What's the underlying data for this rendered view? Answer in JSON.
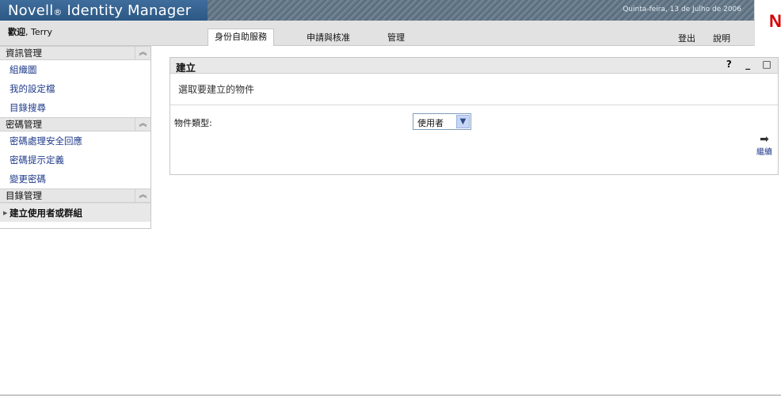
{
  "header": {
    "brand": "Novell",
    "brand_reg": "®",
    "brand_suffix": " Identity Manager",
    "date": "Quinta-feira, 13 de Julho de 2006",
    "logo_letter": "N"
  },
  "subheader": {
    "welcome_label": "歡迎",
    "welcome_user": ", Terry"
  },
  "tabs": {
    "self_service": "身份自助服務",
    "requests": "申請與核准",
    "admin": "管理"
  },
  "toplinks": {
    "logout": "登出",
    "help": "說明"
  },
  "sidebar": {
    "sections": [
      {
        "title": "資訊管理",
        "items": [
          "組織圖",
          "我的設定檔",
          "目錄搜尋"
        ]
      },
      {
        "title": "密碼管理",
        "items": [
          "密碼處理安全回應",
          "密碼提示定義",
          "變更密碼"
        ]
      },
      {
        "title": "目錄管理",
        "items": [
          "建立使用者或群組"
        ]
      }
    ],
    "collapse_glyph": "︽"
  },
  "portlet": {
    "title": "建立",
    "help": "?",
    "minimize": "_",
    "maximize": "□",
    "description": "選取要建立的物件",
    "object_type_label": "物件類型:",
    "object_type_value": "使用者",
    "continue_label": "繼續"
  }
}
